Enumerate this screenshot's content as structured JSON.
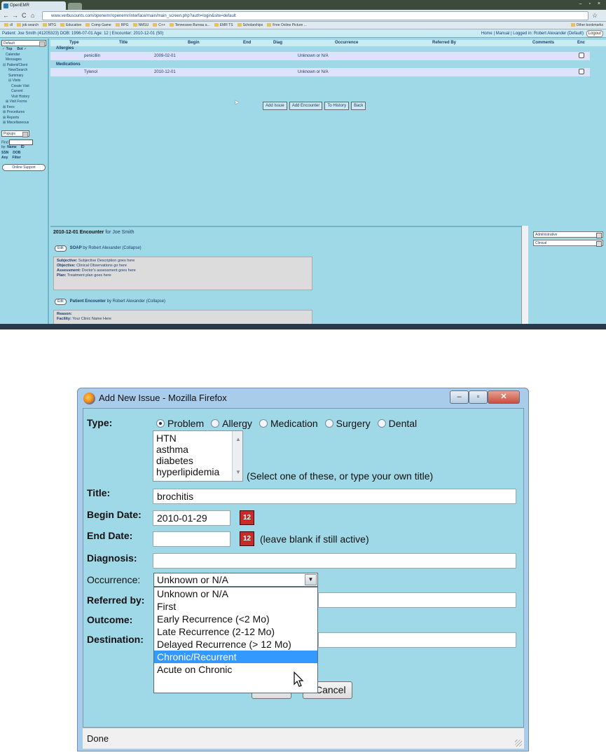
{
  "browser": {
    "tab_title": "OpenEMR",
    "address_url": "www.verbusounts.com/openemr/openemr/interface/main/main_screen.php?auth=login&site=default",
    "bookmarks": [
      "dl",
      "job search",
      "MTG",
      "Education",
      "Comp Game",
      "RPG",
      "NMSU",
      "C++",
      "Tennessee Bureau a...",
      "EMR TS",
      "Scholarships",
      "Free Online Picture ..."
    ],
    "other_bookmarks": "Other bookmarks"
  },
  "patient_bar": {
    "text": "Patient: Joe Smith (41205323) DOB: 1996-07-01 Age: 12 | Encounter: 2010-12-01 (50)",
    "links": "Home | Manual | Logged in: Robert Alexander (Default)",
    "logout": "Logout"
  },
  "left_nav": {
    "selector": "Default",
    "top_label": "Top",
    "bot_label": "Bot",
    "items": [
      {
        "label": "Calendar",
        "level": 1
      },
      {
        "label": "Messages",
        "level": 1
      },
      {
        "label": "⊟ Patient/Client",
        "level": 0
      },
      {
        "label": "New/Search",
        "level": 2
      },
      {
        "label": "Summary",
        "level": 2
      },
      {
        "label": "⊟ Visits",
        "level": 2
      },
      {
        "label": "Create Visit",
        "level": 3
      },
      {
        "label": "Current",
        "level": 3
      },
      {
        "label": "Visit History",
        "level": 3
      },
      {
        "label": "⊞ Visit Forms",
        "level": 1
      },
      {
        "label": "⊞ Fees",
        "level": 0
      },
      {
        "label": "⊞ Procedures",
        "level": 0
      },
      {
        "label": "⊞ Reports",
        "level": 0
      },
      {
        "label": "⊞ Miscellaneous",
        "level": 0
      }
    ],
    "popups_label": "Popups",
    "find_label": "Find",
    "by_label": "by:",
    "search_options": [
      "Name",
      "ID",
      "SSN",
      "DOB",
      "Any",
      "Filter"
    ],
    "support_label": "Online Support"
  },
  "issues_table": {
    "headers": [
      "Type",
      "Title",
      "Begin",
      "End",
      "Diag",
      "Occurrence",
      "Referred By",
      "Comments",
      "Enc"
    ],
    "sections": [
      {
        "name": "Allergies",
        "rows": [
          {
            "title": "penicillin",
            "begin": "2009-02-01",
            "occurrence": "Unknown or N/A"
          }
        ]
      },
      {
        "name": "Medications",
        "rows": [
          {
            "title": "Tylenol",
            "begin": "2010-12-01",
            "occurrence": "Unknown or N/A"
          }
        ]
      }
    ],
    "buttons": [
      "Add Issue",
      "Add Encounter",
      "To History",
      "Back"
    ]
  },
  "encounter": {
    "heading_date": "2010-12-01 Encounter",
    "heading_rest": " for Joe Smith",
    "edit_label": "Edit",
    "soap_title": "SOAP",
    "soap_by": " by Robert Alexander (Collapse)",
    "soap_lines": [
      {
        "k": "Subjective:",
        "v": " Subjective Description goes here"
      },
      {
        "k": "Objective:",
        "v": " Clinical Observations go here"
      },
      {
        "k": "Assessment:",
        "v": " Doctor's assessment goes here"
      },
      {
        "k": "Plan:",
        "v": " Treatment plan goes here"
      }
    ],
    "pe_title": "Patient Encounter",
    "pe_by": " by Robert Alexander (Collapse)",
    "pe_lines": [
      {
        "k": "Reason:",
        "v": ""
      },
      {
        "k": "Facility:",
        "v": " Your Clinic Name Here"
      }
    ],
    "right_selects": [
      "Administrative",
      "Clinical"
    ]
  },
  "dialog": {
    "title": "Add New Issue - Mozilla Firefox",
    "type_label": "Type:",
    "type_options": [
      "Problem",
      "Allergy",
      "Medication",
      "Surgery",
      "Dental"
    ],
    "type_selected": "Problem",
    "title_list": [
      "HTN",
      "asthma",
      "diabetes",
      "hyperlipidemia"
    ],
    "title_list_hint": "(Select one of these, or type your own title)",
    "title_label": "Title:",
    "title_value": "brochitis",
    "begin_label": "Begin Date:",
    "begin_value": "2010-01-29",
    "end_label": "End Date:",
    "end_value": "",
    "end_hint": "(leave blank if still active)",
    "diagnosis_label": "Diagnosis:",
    "diagnosis_value": "",
    "occurrence_label": "Occurrence:",
    "occurrence_value": "Unknown or N/A",
    "occurrence_options": [
      "Unknown or N/A",
      "First",
      "Early Recurrence (<2 Mo)",
      "Late Recurrence (2-12 Mo)",
      "Delayed Recurrence (> 12 Mo)",
      "Chronic/Recurrent",
      "Acute on Chronic"
    ],
    "occurrence_highlighted": "Chronic/Recurrent",
    "referred_label": "Referred by:",
    "outcome_label": "Outcome:",
    "destination_label": "Destination:",
    "cancel_label": "Cancel",
    "status_text": "Done",
    "calendar_glyph": "12"
  }
}
